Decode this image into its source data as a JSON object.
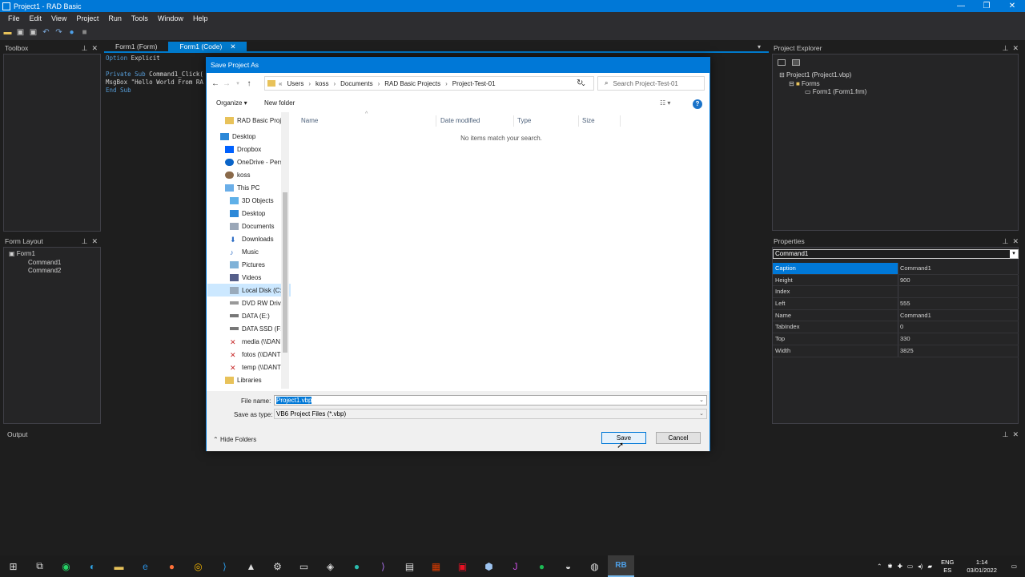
{
  "window": {
    "title": "Project1 - RAD Basic"
  },
  "menu": [
    "File",
    "Edit",
    "View",
    "Project",
    "Run",
    "Tools",
    "Window",
    "Help"
  ],
  "toolbox": {
    "title": "Toolbox"
  },
  "form_layout": {
    "title": "Form Layout",
    "items": [
      "Form1",
      "Command1",
      "Command2"
    ]
  },
  "editor": {
    "tabs": [
      {
        "label": "Form1 (Form)"
      },
      {
        "label": "Form1 (Code)"
      }
    ],
    "lines": [
      {
        "kw": "Option",
        "rest": " Explicit"
      },
      {
        "kw": "",
        "rest": ""
      },
      {
        "kw": "Private Sub",
        "rest": " Command1_Click("
      },
      {
        "kw": "",
        "rest": "MsgBox \"Hello World From RA"
      },
      {
        "kw": "End Sub",
        "rest": ""
      }
    ]
  },
  "project_explorer": {
    "title": "Project Explorer",
    "project": "Project1 (Project1.vbp)",
    "folder": "Forms",
    "form": "Form1 (Form1.frm)"
  },
  "properties": {
    "title": "Properties",
    "selected_object": "Command1",
    "rows": [
      {
        "name": "Caption",
        "value": "Command1"
      },
      {
        "name": "Height",
        "value": "900"
      },
      {
        "name": "Index",
        "value": ""
      },
      {
        "name": "Left",
        "value": "555"
      },
      {
        "name": "Name",
        "value": "Command1"
      },
      {
        "name": "TabIndex",
        "value": "0"
      },
      {
        "name": "Top",
        "value": "330"
      },
      {
        "name": "Width",
        "value": "3825"
      }
    ]
  },
  "output": {
    "title": "Output"
  },
  "dialog": {
    "title": "Save Project As",
    "address": {
      "prefix": "«",
      "parts": [
        "Users",
        "koss",
        "Documents",
        "RAD Basic Projects",
        "Project-Test-01"
      ],
      "separator": "›"
    },
    "search_placeholder": "Search Project-Test-01",
    "organize": "Organize ▾",
    "new_folder": "New folder",
    "nav": [
      "RAD Basic Projec",
      "Desktop",
      "Dropbox",
      "OneDrive - Perso",
      "koss",
      "This PC",
      "3D Objects",
      "Desktop",
      "Documents",
      "Downloads",
      "Music",
      "Pictures",
      "Videos",
      "Local Disk (C:)",
      "DVD RW Drive",
      "DATA (E:)",
      "DATA SSD (F:)",
      "media (\\\\DAN",
      "fotos (\\\\DANTI",
      "temp (\\\\DANTI",
      "Libraries"
    ],
    "columns": [
      "Name",
      "Date modified",
      "Type",
      "Size"
    ],
    "empty_message": "No items match your search.",
    "file_name_label": "File name:",
    "file_name": "Project1.vbp",
    "save_as_type_label": "Save as type:",
    "save_as_type": "VB6 Project Files (*.vbp)",
    "hide_folders": "Hide Folders",
    "save": "Save",
    "cancel": "Cancel"
  },
  "taskbar": {
    "lang": "ENG",
    "locale": "ES",
    "time": "1:14",
    "date": "03/01/2022"
  },
  "colors": {
    "accent": "#0078d7",
    "ide_bg": "#1e1e1e",
    "panel_bg": "#252526"
  }
}
